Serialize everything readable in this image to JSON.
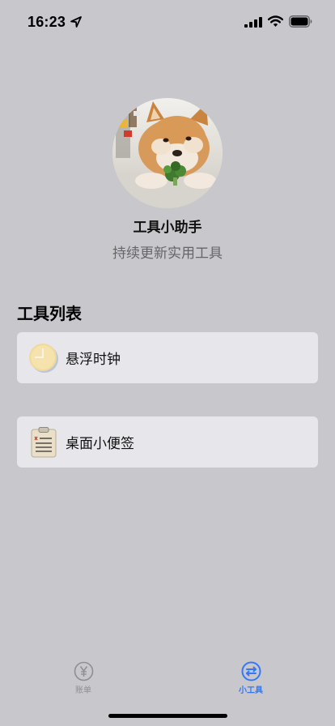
{
  "status_bar": {
    "time": "16:23"
  },
  "profile": {
    "title": "工具小助手",
    "subtitle": "持续更新实用工具"
  },
  "tools_section": {
    "title": "工具列表",
    "items": [
      {
        "label": "悬浮时钟",
        "icon": "clock-icon"
      },
      {
        "label": "桌面小便签",
        "icon": "clipboard-note-icon"
      }
    ]
  },
  "tab_bar": {
    "tabs": [
      {
        "label": "账单",
        "icon": "yen-circle-icon",
        "active": false
      },
      {
        "label": "小工具",
        "icon": "tools-circle-icon",
        "active": true
      }
    ]
  },
  "colors": {
    "background": "#c8c7cc",
    "card": "#e7e6eb",
    "accent": "#3478f6",
    "inactive": "#8e8e93"
  }
}
